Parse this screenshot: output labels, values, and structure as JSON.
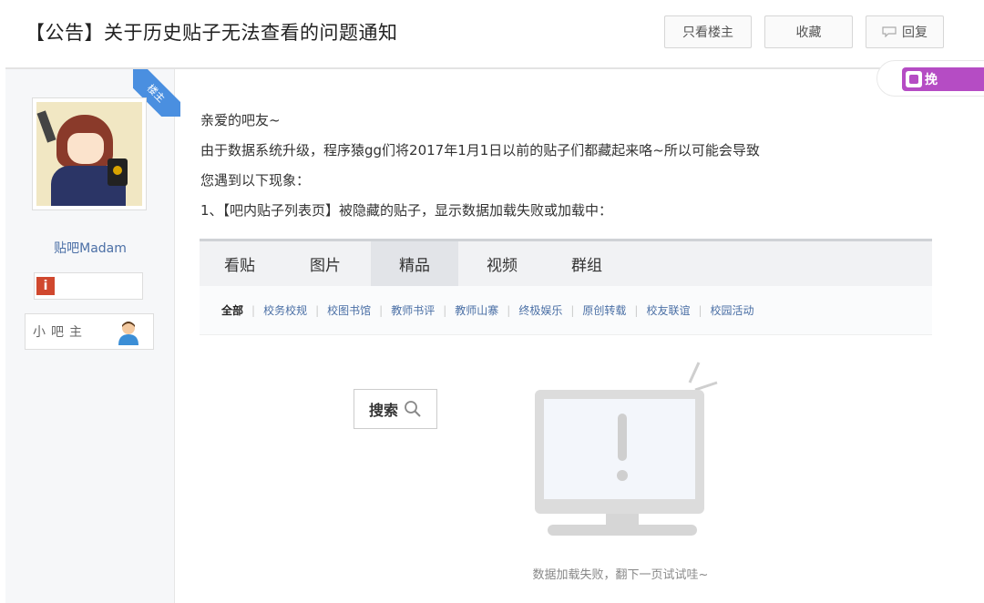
{
  "header": {
    "title": "【公告】关于历史贴子无法查看的问题通知",
    "only_owner_label": "只看楼主",
    "favorite_label": "收藏",
    "reply_label": "回复"
  },
  "help_tab": {
    "label": "挽"
  },
  "sidebar": {
    "corner_label": "楼主",
    "username": "贴吧Madam",
    "level_icon": "i",
    "role": "小吧主"
  },
  "content": {
    "lines": [
      "亲爱的吧友~",
      "由于数据系统升级，程序猿gg们将2017年1月1日以前的贴子们都藏起来咯~所以可能会导致",
      "您遇到以下现象：",
      "1、【吧内贴子列表页】被隐藏的贴子，显示数据加载失败或加载中："
    ]
  },
  "embed": {
    "tabs": [
      {
        "label": "看贴",
        "active": false
      },
      {
        "label": "图片",
        "active": false
      },
      {
        "label": "精品",
        "active": true
      },
      {
        "label": "视频",
        "active": false
      },
      {
        "label": "群组",
        "active": false
      }
    ],
    "subnav": [
      "全部",
      "校务校规",
      "校图书馆",
      "教师书评",
      "教师山寨",
      "终极娱乐",
      "原创转载",
      "校友联谊",
      "校园活动"
    ],
    "search_label": "搜索",
    "error_text": "数据加载失败，翻下一页试试哇~"
  },
  "colors": {
    "accent_blue": "#4a8fe0",
    "help_purple": "#b54cc4",
    "link_blue": "#4a6fa5"
  }
}
